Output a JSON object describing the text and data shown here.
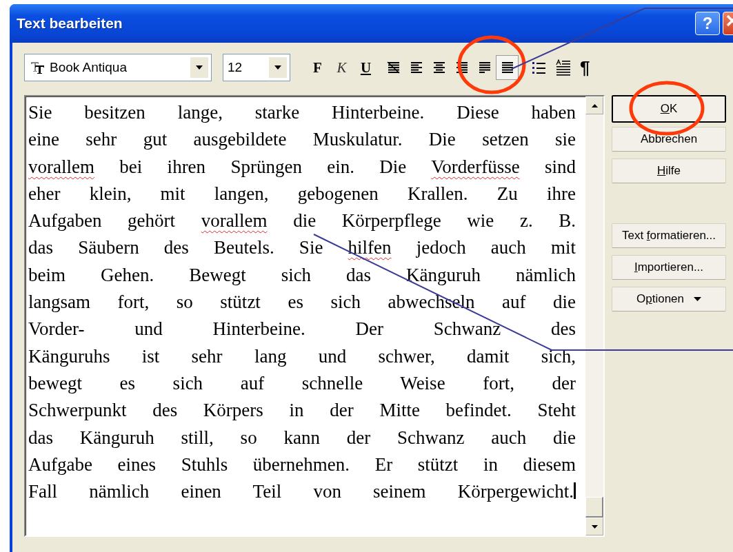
{
  "window": {
    "title": "Text bearbeiten",
    "help_button": "?"
  },
  "toolbar": {
    "font": "Book Antiqua",
    "size": "12",
    "styles": [
      {
        "label": "F",
        "kind": "bold"
      },
      {
        "label": "K",
        "kind": "italic"
      },
      {
        "label": "U",
        "kind": "underline"
      }
    ],
    "alignments": [
      {
        "kind": "none",
        "selected": false
      },
      {
        "kind": "left",
        "selected": false
      },
      {
        "kind": "center",
        "selected": false
      },
      {
        "kind": "right",
        "selected": false
      },
      {
        "kind": "justify",
        "selected": false
      },
      {
        "kind": "full",
        "selected": true
      }
    ],
    "pilcrow": "¶"
  },
  "editor": {
    "lines": [
      [
        {
          "text": "Sie besitzen lange, starke Hinterbeine. Diese haben",
          "misspelled": false
        }
      ],
      [
        {
          "text": "eine sehr gut ausgebildete Muskulatur. Die setzen sie",
          "misspelled": false
        }
      ],
      [
        {
          "text": "vorallem",
          "misspelled": true
        },
        {
          "text": " bei ihren Sprüngen ein. Die ",
          "misspelled": false
        },
        {
          "text": "Vorderfüsse",
          "misspelled": true
        },
        {
          "text": " sind",
          "misspelled": false
        }
      ],
      [
        {
          "text": "eher klein, mit langen, gebogenen Krallen. Zu ihre",
          "misspelled": false
        }
      ],
      [
        {
          "text": "Aufgaben gehört ",
          "misspelled": false
        },
        {
          "text": "vorallem",
          "misspelled": true
        },
        {
          "text": " die Körperpflege wie z. B.",
          "misspelled": false
        }
      ],
      [
        {
          "text": "das Säubern des Beutels. Sie ",
          "misspelled": false
        },
        {
          "text": "hilfen",
          "misspelled": true
        },
        {
          "text": " jedoch auch mit",
          "misspelled": false
        }
      ],
      [
        {
          "text": "beim Gehen. Bewegt sich das Känguruh nämlich",
          "misspelled": false
        }
      ],
      [
        {
          "text": "langsam fort, so stützt es sich abwechseln auf die",
          "misspelled": false
        }
      ],
      [
        {
          "text": "Vorder- und Hinterbeine. Der Schwanz des",
          "misspelled": false
        }
      ],
      [
        {
          "text": "Känguruhs ist sehr lang und schwer, damit sich,",
          "misspelled": false
        }
      ],
      [
        {
          "text": "bewegt es sich auf schnelle Weise fort, der",
          "misspelled": false
        }
      ],
      [
        {
          "text": "Schwerpunkt des Körpers in der Mitte befindet. Steht",
          "misspelled": false
        }
      ],
      [
        {
          "text": "das Känguruh still, so kann der Schwanz auch die",
          "misspelled": false
        }
      ],
      [
        {
          "text": "Aufgabe eines Stuhls übernehmen. Er stützt in diesem",
          "misspelled": false
        }
      ],
      [
        {
          "text": "Fall nämlich einen Teil von seinem Körpergewicht.",
          "misspelled": false
        }
      ]
    ]
  },
  "buttons": [
    {
      "accel": "O",
      "label_rest": "K",
      "default": true,
      "kind": "plain"
    },
    {
      "label_start": "Abbrechen",
      "default": false,
      "kind": "plain"
    },
    {
      "accel": "H",
      "label_rest": "ilfe",
      "default": false,
      "kind": "plain"
    },
    {
      "kind": "gap"
    },
    {
      "label_start": "Text ",
      "accel": "f",
      "label_rest": "ormatieren...",
      "default": false,
      "kind": "plain"
    },
    {
      "accel": "I",
      "label_rest": "mportieren...",
      "default": false,
      "kind": "plain"
    },
    {
      "label_start": "O",
      "accel": "p",
      "label_rest": "tionen",
      "default": false,
      "kind": "menu"
    }
  ]
}
